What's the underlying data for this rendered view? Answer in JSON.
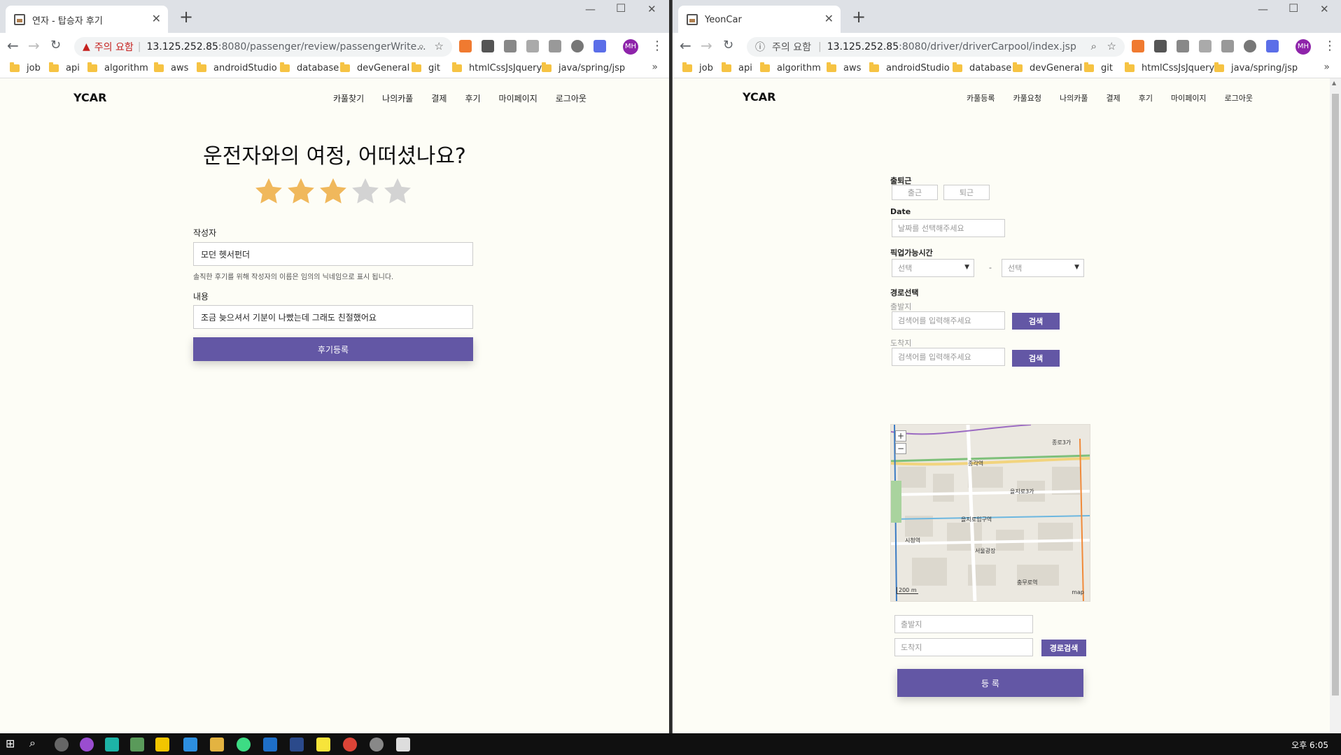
{
  "left_window": {
    "tab_title": "연자 - 탑승자 후기",
    "address": {
      "warning": "주의 요함",
      "host": "13.125.252.85",
      "path": ":8080/passenger/review/passengerWrite..."
    },
    "bookmarks": [
      "job",
      "api",
      "algorithm",
      "aws",
      "androidStudio",
      "database",
      "devGeneral",
      "git",
      "htmlCssJsJquery",
      "java/spring/jsp"
    ],
    "site": {
      "logo": "YCAR",
      "nav": [
        "카풀찾기",
        "나의카풀",
        "결제",
        "후기",
        "마이페이지",
        "로그아웃"
      ],
      "heading": "운전자와의 여정, 어떠셨나요?",
      "rating": 3,
      "rating_max": 5,
      "author_label": "작성자",
      "author_value": "모던 헷서펀더",
      "author_hint": "솔직한 후기를 위해 작성자의 이름은 임의의 닉네임으로 표시 됩니다.",
      "content_label": "내용",
      "content_value": "조금 늦으셔서 기분이 나빴는데 그래도 친절했어요",
      "submit_label": "후기등록"
    }
  },
  "right_window": {
    "tab_title": "YeonCar",
    "address": {
      "warning": "주의 요함",
      "host": "13.125.252.85",
      "path": ":8080/driver/driverCarpool/index.jsp"
    },
    "bookmarks": [
      "job",
      "api",
      "algorithm",
      "aws",
      "androidStudio",
      "database",
      "devGeneral",
      "git",
      "htmlCssJsJquery",
      "java/spring/jsp"
    ],
    "site": {
      "logo": "YCAR",
      "nav": [
        "카풀등록",
        "카풀요청",
        "나의카풀",
        "결제",
        "후기",
        "마이페이지",
        "로그아웃"
      ],
      "commute_label": "출퇴근",
      "commute_options": [
        "출근",
        "퇴근"
      ],
      "date_label": "Date",
      "date_placeholder": "날짜를 선택해주세요",
      "pickup_label": "픽업가능시간",
      "pickup_from": "선택",
      "pickup_sep": "-",
      "pickup_to": "선택",
      "route_label": "경로선택",
      "origin_label": "출발지",
      "origin_placeholder": "검색어를 입력해주세요",
      "origin_search": "검색",
      "dest_label": "도착지",
      "dest_placeholder": "검색어를 입력해주세요",
      "dest_search": "검색",
      "map": {
        "zoom_in": "+",
        "zoom_out": "−",
        "scale": "200 m",
        "brand": "map",
        "places": [
          "종로3가",
          "종각역",
          "을지로입구역",
          "시청역",
          "충무로역",
          "을지로3가",
          "서울광장"
        ]
      },
      "origin_field": "출발지",
      "dest_field": "도착지",
      "route_search": "경로검색",
      "register": "등 록"
    }
  },
  "taskbar": {
    "clock": "오후 6:05"
  },
  "colors": {
    "accent": "#6357a5",
    "star_on": "#f0b85c",
    "star_off": "#d3d3d3",
    "page_bg": "#fdfdf6"
  }
}
